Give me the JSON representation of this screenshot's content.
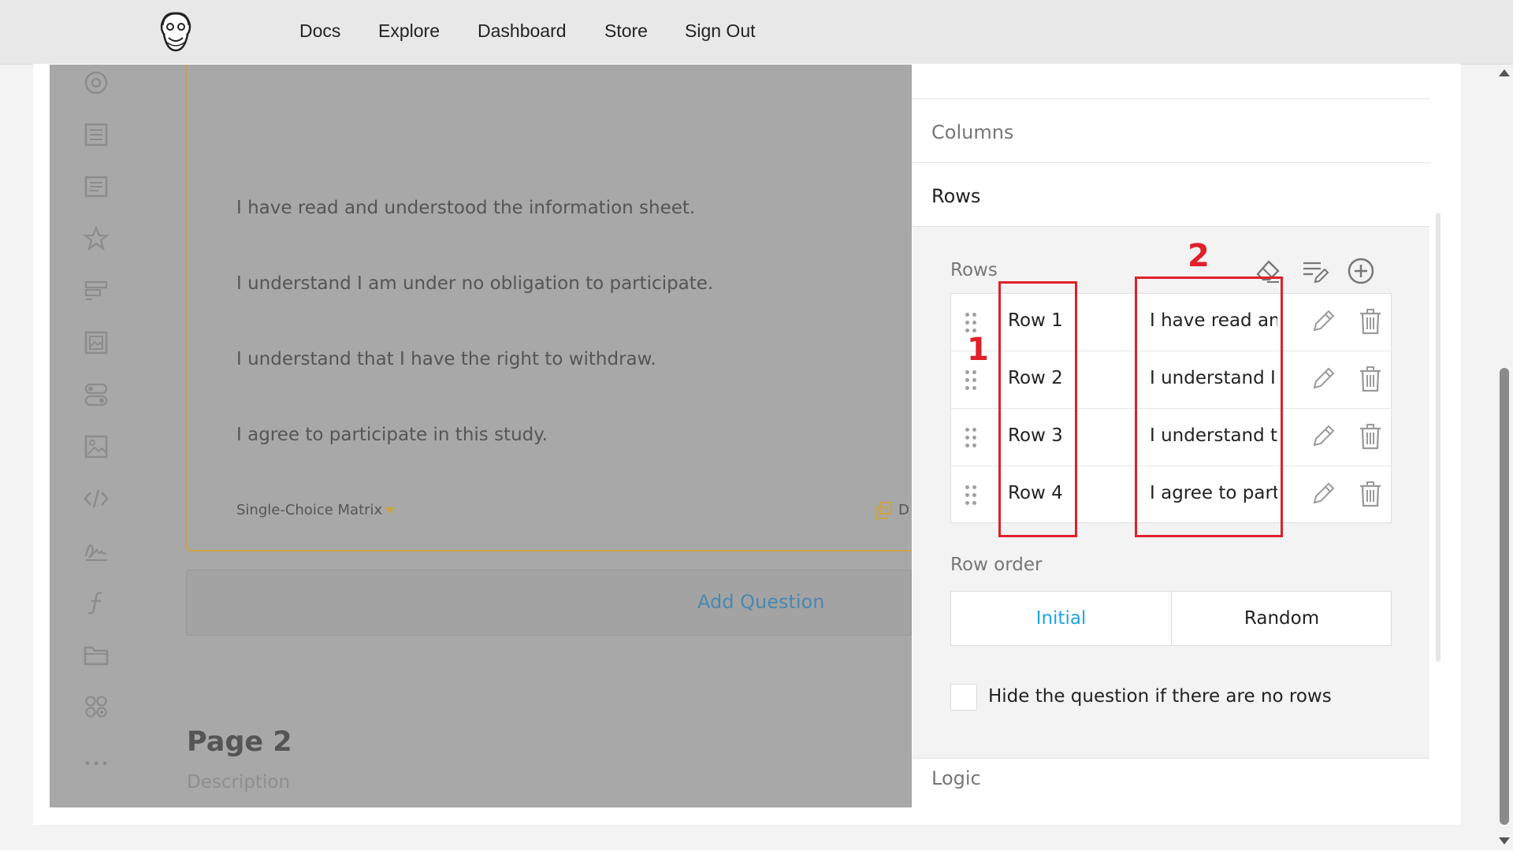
{
  "nav": {
    "items": [
      "Docs",
      "Explore",
      "Dashboard",
      "Store",
      "Sign Out"
    ]
  },
  "toolbox": {
    "icons": [
      "radiogroup-icon",
      "dropdown-icon",
      "comment-icon",
      "rating-icon",
      "ranking-icon",
      "image-picker-icon",
      "boolean-icon",
      "image-icon",
      "html-icon",
      "signature-pad-icon",
      "expression-icon",
      "file-icon",
      "matrix-icon",
      "more-icon"
    ]
  },
  "question": {
    "rows": [
      "I have read and understood the information sheet.",
      "I understand I am under no obligation to participate.",
      "I understand that I have the right to withdraw.",
      "I agree to participate in this study."
    ],
    "type_label": "Single-Choice Matrix",
    "duplicate_label": "D"
  },
  "add_question_label": "Add Question",
  "page": {
    "title": "Page 2",
    "description": "Description"
  },
  "panel": {
    "sections": {
      "columns": "Columns",
      "rows": "Rows",
      "logic": "Logic"
    },
    "rows_label": "Rows",
    "items": [
      {
        "value": "Row 1",
        "text": "I have read and understood the information sheet."
      },
      {
        "value": "Row 2",
        "text": "I understand I am under no obligation to participate."
      },
      {
        "value": "Row 3",
        "text": "I understand that I have the right to withdraw."
      },
      {
        "value": "Row 4",
        "text": "I agree to participate in this study."
      }
    ],
    "row_order_label": "Row order",
    "row_order": {
      "initial": "Initial",
      "random": "Random",
      "selected": "Initial"
    },
    "hide_label": "Hide the question if there are no rows"
  },
  "annotations": {
    "one": "1",
    "two": "2"
  },
  "colors": {
    "accent": "#19b394",
    "link_blue": "#1ea5e0",
    "annotation_red": "#e0202a",
    "card_border": "#c9a449"
  }
}
